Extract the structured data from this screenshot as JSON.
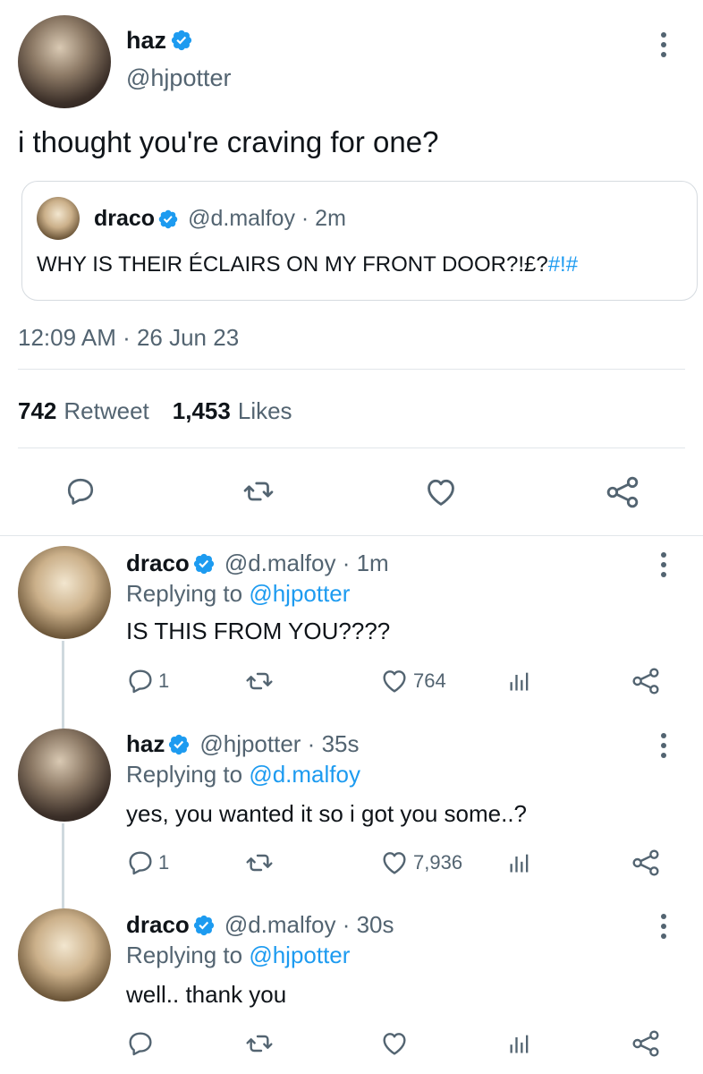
{
  "main_tweet": {
    "author_name": "haz",
    "author_handle": "@hjpotter",
    "text": "i thought you're craving for one?",
    "quoted": {
      "author_name": "draco",
      "handle_time": "@d.malfoy · 2m",
      "text_plain": "WHY IS THEIR ÉCLAIRS ON MY FRONT DOOR?!£?",
      "text_link": "#!#"
    },
    "timestamp": "12:09 AM · 26 Jun 23",
    "retweets_count": "742",
    "retweets_label": "Retweet",
    "likes_count": "1,453",
    "likes_label": "Likes"
  },
  "replies": [
    {
      "author_name": "draco",
      "handle_time": "@d.malfoy · 1m",
      "replying_label": "Replying to",
      "replying_to": "@hjpotter",
      "text": "IS THIS FROM YOU????",
      "reply_count": "1",
      "like_count": "764"
    },
    {
      "author_name": "haz",
      "handle_time": "@hjpotter · 35s",
      "replying_label": "Replying to",
      "replying_to": "@d.malfoy",
      "text": "yes, you wanted it so i got you some..?",
      "reply_count": "1",
      "like_count": "7,936"
    },
    {
      "author_name": "draco",
      "handle_time": "@d.malfoy · 30s",
      "replying_label": "Replying to",
      "replying_to": "@hjpotter",
      "text": "well.. thank you",
      "reply_count": "",
      "like_count": ""
    }
  ],
  "colors": {
    "accent": "#1d9bf0",
    "muted": "#536471",
    "text": "#0f1419",
    "divider": "#e1e6ea"
  },
  "icons": [
    "verified-badge-icon",
    "more-options-icon",
    "reply-icon",
    "retweet-icon",
    "like-icon",
    "share-icon",
    "analytics-icon"
  ]
}
